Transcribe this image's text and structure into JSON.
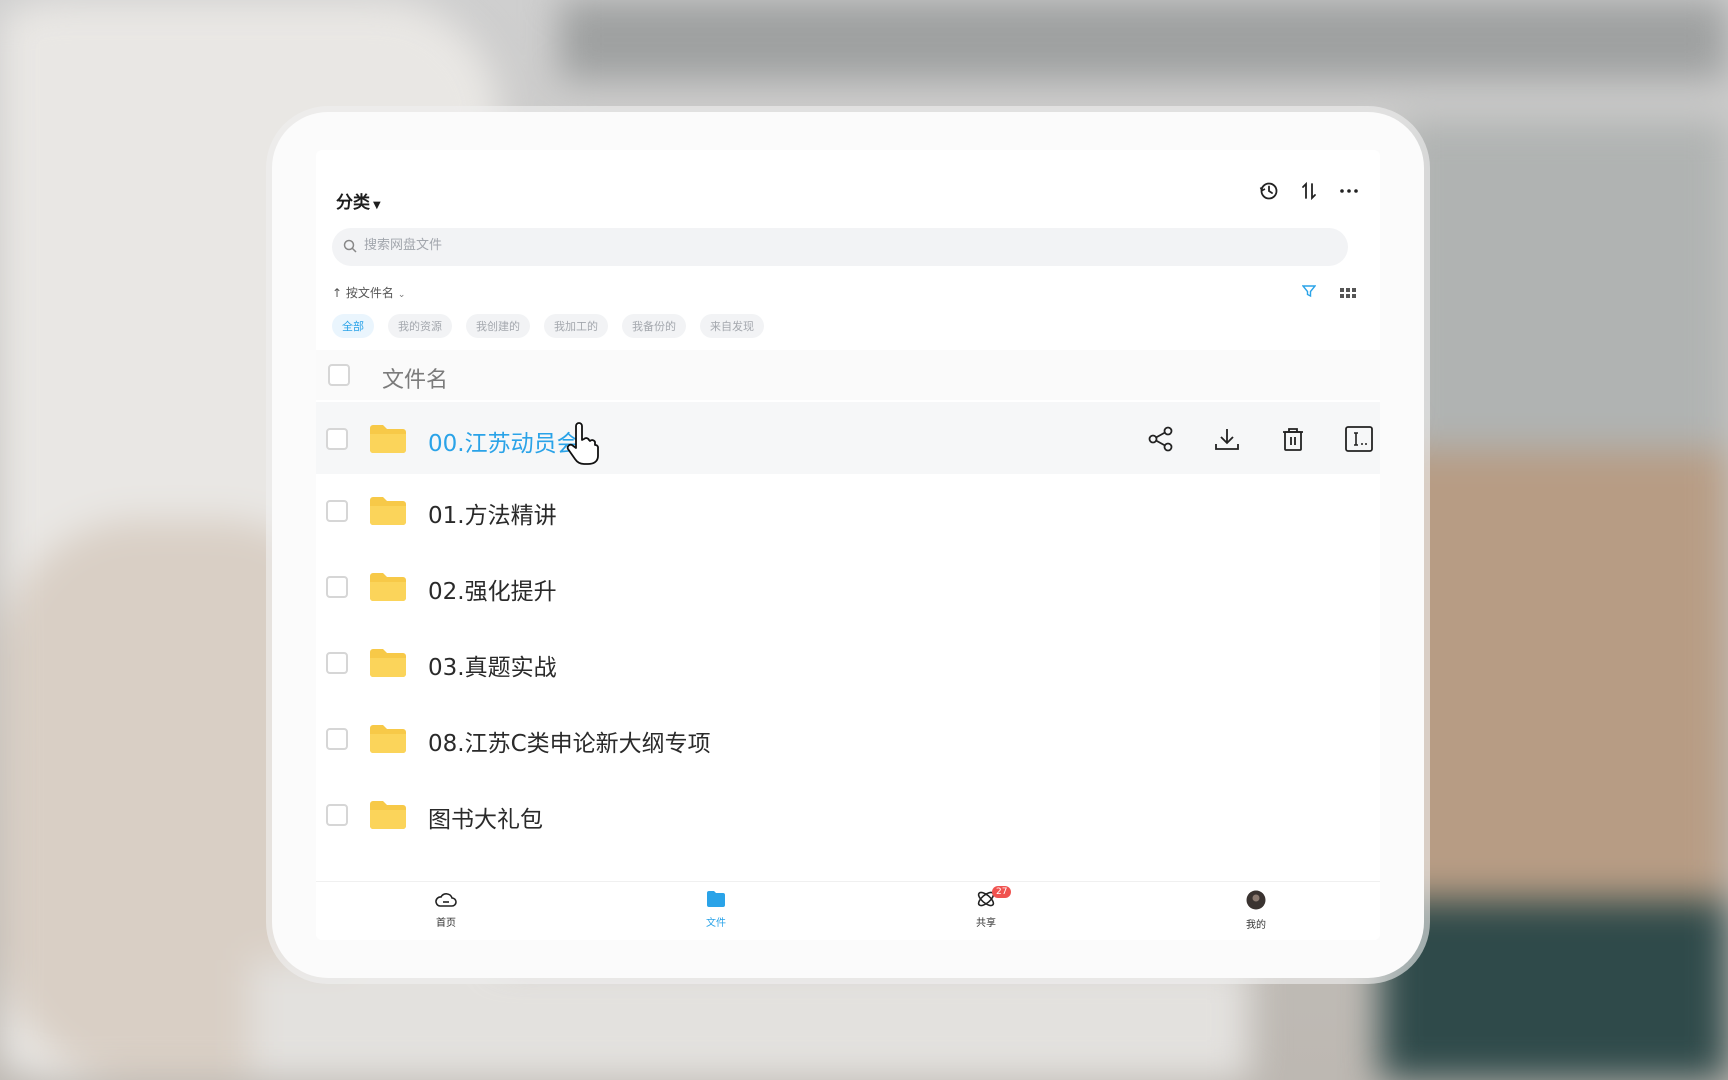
{
  "header": {
    "category_label": "分类"
  },
  "search": {
    "placeholder": "搜索网盘文件"
  },
  "sort": {
    "label": "按文件名"
  },
  "chips": [
    "全部",
    "我的资源",
    "我创建的",
    "我加工的",
    "我备份的",
    "来自发现"
  ],
  "list": {
    "column_header": "文件名",
    "items": [
      {
        "name": "00.江苏动员会"
      },
      {
        "name": "01.方法精讲"
      },
      {
        "name": "02.强化提升"
      },
      {
        "name": "03.真题实战"
      },
      {
        "name": "08.江苏C类申论新大纲专项"
      },
      {
        "name": "图书大礼包"
      }
    ]
  },
  "bottom_nav": {
    "home": "首页",
    "files": "文件",
    "share": "共享",
    "share_badge": "27",
    "me": "我的"
  },
  "colors": {
    "accent": "#2aa3e8",
    "folder": "#f7c948",
    "badge": "#f0524f"
  },
  "icons": [
    "history-icon",
    "sort-icon",
    "more-icon",
    "search-icon",
    "filter-icon",
    "grid-view-icon",
    "folder-icon",
    "share-icon",
    "download-icon",
    "delete-icon",
    "rename-icon",
    "home-icon",
    "files-icon",
    "share-tab-icon",
    "avatar"
  ]
}
